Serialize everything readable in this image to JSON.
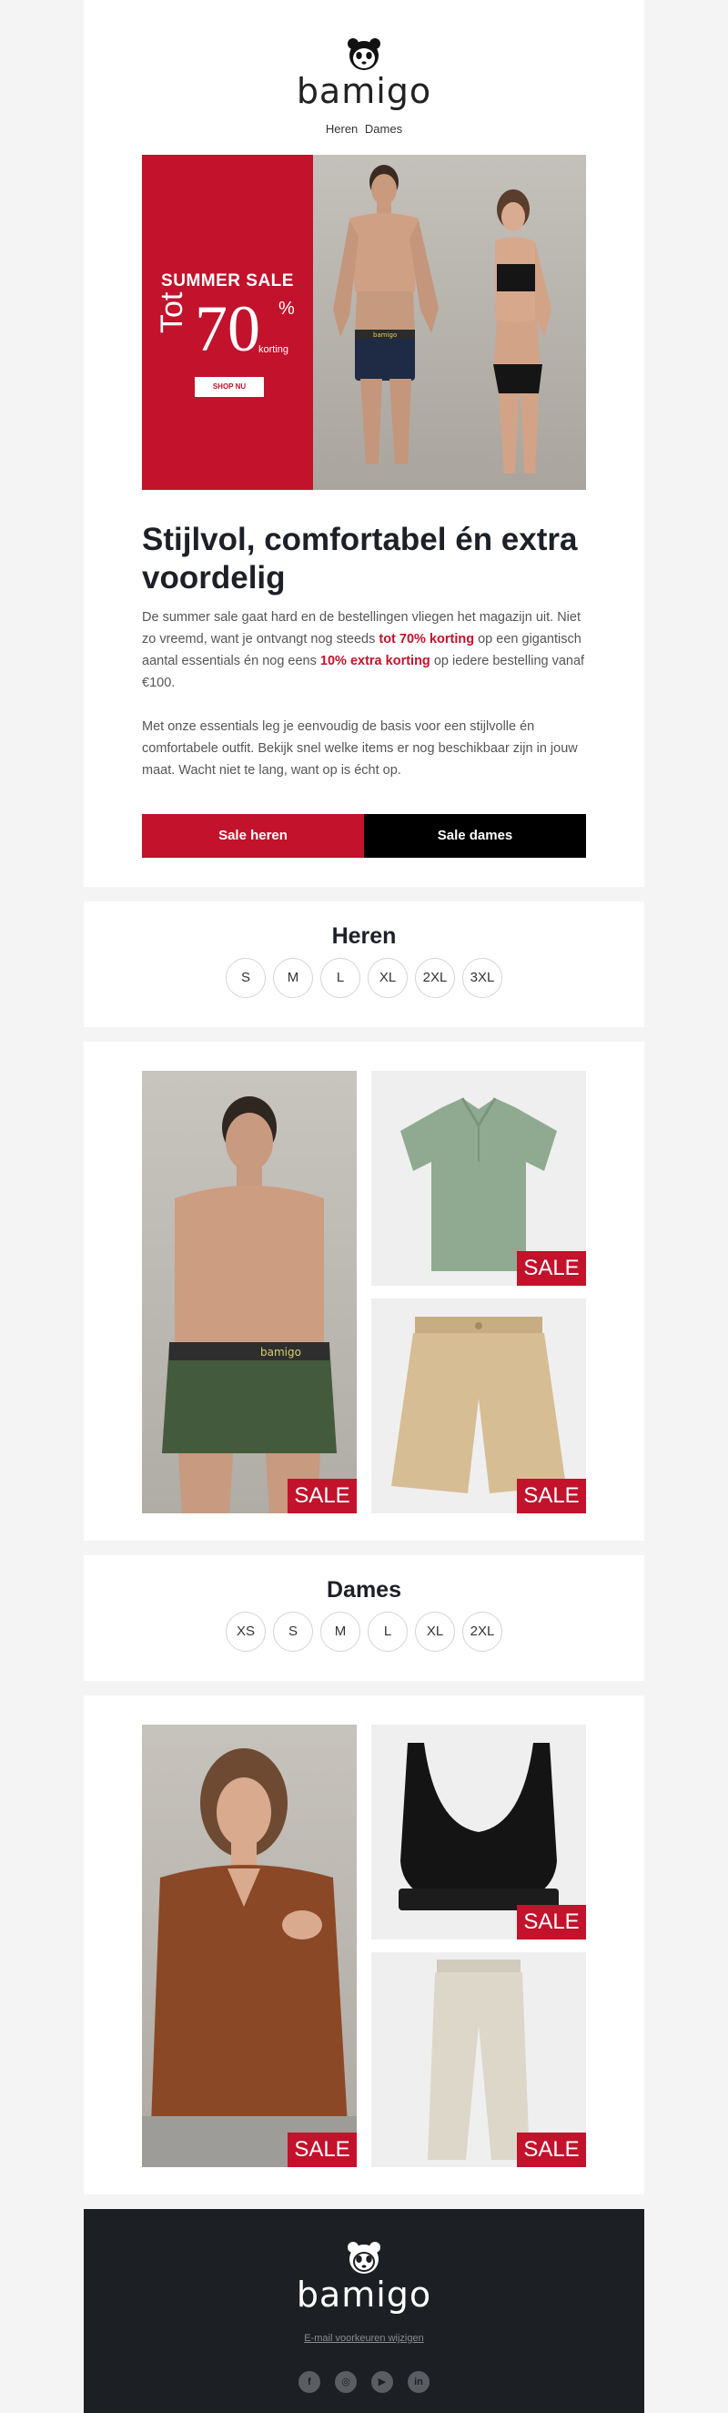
{
  "brand": {
    "name": "bamigo"
  },
  "nav": {
    "items": [
      "Heren",
      "Dames"
    ]
  },
  "banner": {
    "title": "SUMMER SALE",
    "prefix": "Tot",
    "percent": "70",
    "percent_sign": "%",
    "korting": "korting",
    "button": "SHOP NU"
  },
  "content": {
    "headline": "Stijlvol, comfortabel én extra voordelig",
    "p1": {
      "a": "De summer sale gaat hard en de bestellingen vliegen het magazijn uit. Niet zo vreemd, want je ontvangt nog steeds ",
      "hl1": "tot 70% korting",
      "b": " op een gigantisch aantal essentials én nog eens ",
      "hl2": "10% extra korting",
      "c": " op iedere bestelling vanaf €100."
    },
    "p2": "Met onze essentials leg je eenvoudig de basis voor een stijlvolle én comfortabele outfit. Bekijk snel welke items er nog beschikbaar zijn in jouw maat. Wacht niet te lang, want op is écht op.",
    "cta_heren": "Sale heren",
    "cta_dames": "Sale dames"
  },
  "heren": {
    "title": "Heren",
    "sizes": [
      "S",
      "M",
      "L",
      "XL",
      "2XL",
      "3XL"
    ],
    "products": [
      {
        "badge": "SALE",
        "icon": "man-boxer-photo"
      },
      {
        "badge": "SALE",
        "icon": "polo-shirt-photo"
      },
      {
        "badge": "SALE",
        "icon": "chino-shorts-photo"
      }
    ]
  },
  "dames": {
    "title": "Dames",
    "sizes": [
      "XS",
      "S",
      "M",
      "L",
      "XL",
      "2XL"
    ],
    "products": [
      {
        "badge": "SALE",
        "icon": "woman-tshirt-photo"
      },
      {
        "badge": "SALE",
        "icon": "bralette-photo"
      },
      {
        "badge": "SALE",
        "icon": "trousers-photo"
      }
    ]
  },
  "footer": {
    "link": "E-mail voorkeuren wijzigen",
    "social": [
      "f",
      "◎",
      "▶",
      "in"
    ]
  },
  "colors": {
    "accent": "#c2122c",
    "dark": "#1c1f23",
    "black": "#000000"
  }
}
